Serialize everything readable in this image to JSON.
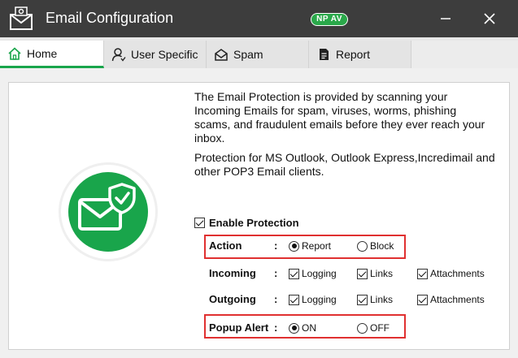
{
  "window": {
    "title": "Email Configuration",
    "logo_text": "NP AV",
    "minimize_glyph": "—",
    "close_glyph": "✕"
  },
  "tabs": [
    {
      "label": "Home",
      "icon": "home-icon",
      "active": true
    },
    {
      "label": "User Specific",
      "icon": "user-icon",
      "active": false
    },
    {
      "label": "Spam",
      "icon": "spam-envelope-icon",
      "active": false
    },
    {
      "label": "Report",
      "icon": "report-icon",
      "active": false
    }
  ],
  "description": {
    "p1": "The Email Protection is provided by scanning your Incoming Emails for spam, viruses, worms, phishing scams, and fraudulent emails before they ever reach your inbox.",
    "p2": "Protection for MS Outlook, Outlook Express,Incredimail and other POP3 Email clients."
  },
  "enable_protection": {
    "label": "Enable Protection",
    "checked": true
  },
  "settings": {
    "colon": ":",
    "action": {
      "label": "Action",
      "options": [
        {
          "label": "Report",
          "selected": true
        },
        {
          "label": "Block",
          "selected": false
        }
      ]
    },
    "incoming": {
      "label": "Incoming",
      "options": [
        {
          "label": "Logging",
          "checked": true
        },
        {
          "label": "Links",
          "checked": true
        },
        {
          "label": "Attachments",
          "checked": true
        }
      ]
    },
    "outgoing": {
      "label": "Outgoing",
      "options": [
        {
          "label": "Logging",
          "checked": true
        },
        {
          "label": "Links",
          "checked": true
        },
        {
          "label": "Attachments",
          "checked": true
        }
      ]
    },
    "popup_alert": {
      "label": "Popup Alert",
      "options": [
        {
          "label": "ON",
          "selected": true
        },
        {
          "label": "OFF",
          "selected": false
        }
      ]
    }
  },
  "colors": {
    "accent_green": "#19a54b",
    "titlebar": "#3d3d3d",
    "highlight": "#e03030"
  }
}
